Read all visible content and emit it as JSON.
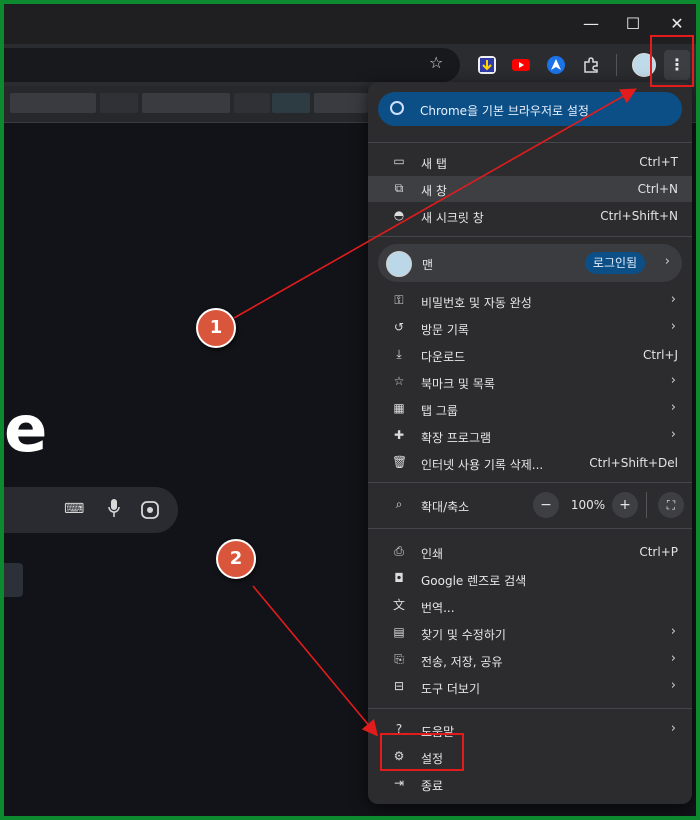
{
  "window": {
    "minimize_icon": "minimize-icon",
    "maximize_icon": "maximize-icon",
    "close_icon": "close-icon"
  },
  "toolbar": {
    "bookmark_icon": "star-icon",
    "extensions": [
      "download-ext-icon",
      "youtube-ext-icon",
      "arrow-ext-icon",
      "puzzle-icon"
    ],
    "more_icon": "kebab-icon"
  },
  "page": {
    "logo_fragment": "e"
  },
  "menu": {
    "default_browser": "Chrome을 기본 브라우저로 설정",
    "new_tab": {
      "label": "새 탭",
      "shortcut": "Ctrl+T"
    },
    "new_window": {
      "label": "새 창",
      "shortcut": "Ctrl+N"
    },
    "incognito": {
      "label": "새 시크릿 창",
      "shortcut": "Ctrl+Shift+N"
    },
    "profile": {
      "name": "맨",
      "status": "로그인됨"
    },
    "passwords": {
      "label": "비밀번호 및 자동 완성"
    },
    "history": {
      "label": "방문 기록"
    },
    "downloads": {
      "label": "다운로드",
      "shortcut": "Ctrl+J"
    },
    "bookmarks": {
      "label": "북마크 및 목록"
    },
    "tab_groups": {
      "label": "탭 그룹"
    },
    "extensions": {
      "label": "확장 프로그램"
    },
    "clear_data": {
      "label": "인터넷 사용 기록 삭제...",
      "shortcut": "Ctrl+Shift+Del"
    },
    "zoom": {
      "label": "확대/축소",
      "minus": "−",
      "value": "100%",
      "plus": "+"
    },
    "print": {
      "label": "인쇄",
      "shortcut": "Ctrl+P"
    },
    "lens": {
      "label": "Google 렌즈로 검색"
    },
    "translate": {
      "label": "번역..."
    },
    "find": {
      "label": "찾기 및 수정하기"
    },
    "cast": {
      "label": "전송, 저장, 공유"
    },
    "more_tools": {
      "label": "도구 더보기"
    },
    "help": {
      "label": "도움말"
    },
    "settings": {
      "label": "설정"
    },
    "exit": {
      "label": "종료"
    }
  },
  "annotations": {
    "step1": "1",
    "step2": "2",
    "color": "#e21c1c"
  }
}
